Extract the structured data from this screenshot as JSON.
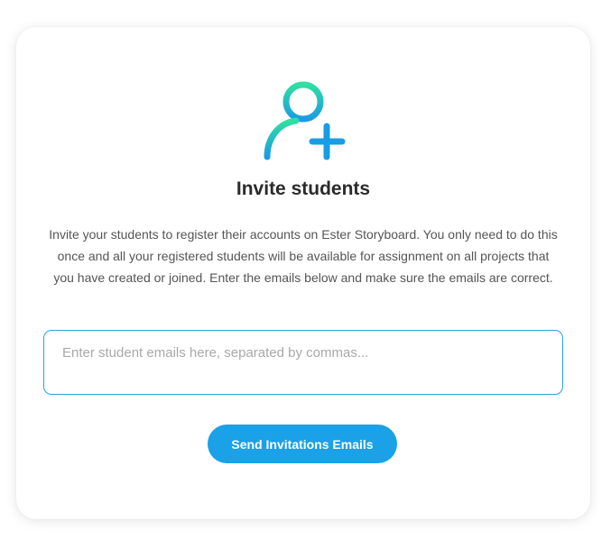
{
  "invite": {
    "icon": "user-plus-icon",
    "title": "Invite students",
    "description": "Invite your students to register their accounts on Ester Storyboard. You only need to do this once and all your registered students will be available for assignment on all projects that you have created or joined. Enter the emails below and make sure the emails are correct.",
    "email_input": {
      "value": "",
      "placeholder": "Enter student emails here, separated by commas..."
    },
    "send_button_label": "Send Invitations Emails"
  },
  "colors": {
    "accent_blue": "#1aa1e8",
    "icon_gradient_start": "#2fe0a0",
    "icon_gradient_end": "#1a9be6",
    "input_border": "#2aa3df"
  }
}
